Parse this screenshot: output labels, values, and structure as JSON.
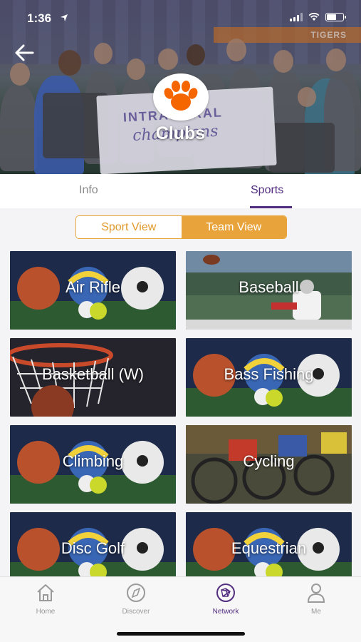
{
  "status_bar": {
    "time": "1:36"
  },
  "header": {
    "title": "Clubs",
    "banner_text": "TIGERS",
    "sign_title": "INTRAMURAL",
    "sign_subtitle": "champions"
  },
  "tabs": [
    {
      "label": "Info",
      "active": false
    },
    {
      "label": "Sports",
      "active": true
    }
  ],
  "view_toggle": {
    "options": [
      {
        "label": "Sport View",
        "selected": false
      },
      {
        "label": "Team View",
        "selected": true
      }
    ]
  },
  "tiles": [
    {
      "label": "Air Rifle",
      "image": "sports-balls"
    },
    {
      "label": "Baseball",
      "image": "football-player"
    },
    {
      "label": "Basketball (W)",
      "image": "basketball-hoop"
    },
    {
      "label": "Bass Fishing",
      "image": "sports-balls"
    },
    {
      "label": "Climbing",
      "image": "sports-balls"
    },
    {
      "label": "Cycling",
      "image": "cyclists"
    },
    {
      "label": "Disc Golf",
      "image": "sports-balls"
    },
    {
      "label": "Equestrian",
      "image": "sports-balls"
    }
  ],
  "bottom_nav": [
    {
      "label": "Home",
      "icon": "home-icon",
      "active": false
    },
    {
      "label": "Discover",
      "icon": "compass-icon",
      "active": false
    },
    {
      "label": "Network",
      "icon": "network-icon",
      "active": true
    },
    {
      "label": "Me",
      "icon": "person-icon",
      "active": false
    }
  ],
  "colors": {
    "accent_purple": "#522d80",
    "accent_orange": "#e8a43a",
    "paw_orange": "#f56600"
  }
}
